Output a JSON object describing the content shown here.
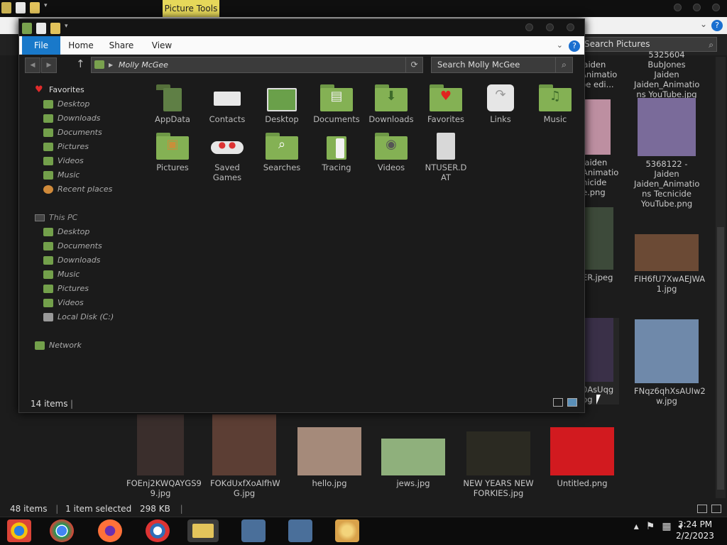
{
  "background_window": {
    "contextual_tab": "Picture Tools",
    "search_placeholder": "Search Pictures",
    "items": [
      {
        "label": "5325604 BubJones Jaiden Jaiden_Animatio ns YouTube.jpg"
      },
      {
        "label": "5368122 - Jaiden Jaiden_Animatio ns Tecnicide YouTube.png"
      },
      {
        "label": "FIH6fU7XwAEJWA 1.jpg"
      },
      {
        "label": "FNqz6qhXsAUIw2 w.jpg"
      },
      {
        "label": "FOEnj2KWQAYGS9 9.jpg"
      },
      {
        "label": "FOKdUxfXoAIfhW G.jpg"
      },
      {
        "label": "hello.jpg"
      },
      {
        "label": "jews.jpg"
      },
      {
        "label": "NEW YEARS NEW FORKIES.jpg"
      },
      {
        "label": "Untitled.png"
      }
    ],
    "partial_labels": [
      "Jaiden Animatio pe edi...",
      "Jaiden Animatio nicide e.png",
      "ER.jpeg",
      "0AsUqg pg"
    ],
    "status": {
      "count": "48 items",
      "selected": "1 item selected",
      "size": "298 KB"
    }
  },
  "window": {
    "ribbon_tabs": {
      "file": "File",
      "home": "Home",
      "share": "Share",
      "view": "View"
    },
    "help": "?",
    "address": "Molly McGee",
    "search_placeholder": "Search Molly McGee",
    "nav": {
      "favorites_header": "Favorites",
      "favorites": [
        "Desktop",
        "Downloads",
        "Documents",
        "Pictures",
        "Videos",
        "Music",
        "Recent places"
      ],
      "thispc_header": "This PC",
      "thispc": [
        "Desktop",
        "Documents",
        "Downloads",
        "Music",
        "Pictures",
        "Videos",
        "Local Disk (C:)"
      ],
      "network": "Network"
    },
    "items": [
      {
        "label": "AppData",
        "icon": "appdata-folder-icon"
      },
      {
        "label": "Contacts",
        "icon": "contacts-icon"
      },
      {
        "label": "Desktop",
        "icon": "desktop-folder-icon"
      },
      {
        "label": "Documents",
        "icon": "documents-folder-icon"
      },
      {
        "label": "Downloads",
        "icon": "downloads-folder-icon"
      },
      {
        "label": "Favorites",
        "icon": "favorites-folder-icon"
      },
      {
        "label": "Links",
        "icon": "links-icon"
      },
      {
        "label": "Music",
        "icon": "music-folder-icon"
      },
      {
        "label": "Pictures",
        "icon": "pictures-folder-icon"
      },
      {
        "label": "Saved Games",
        "icon": "saved-games-icon"
      },
      {
        "label": "Searches",
        "icon": "searches-folder-icon"
      },
      {
        "label": "Tracing",
        "icon": "tracing-folder-icon"
      },
      {
        "label": "Videos",
        "icon": "videos-folder-icon"
      },
      {
        "label": "NTUSER.DAT",
        "icon": "file-icon"
      }
    ],
    "status": {
      "count": "14 items"
    }
  },
  "taskbar": {
    "apps": [
      "chrome-beta-icon",
      "chrome-icon",
      "firefox-icon",
      "obama-logo-icon",
      "file-explorer-icon",
      "installer-icon",
      "installer-icon-2",
      "paint-icon"
    ],
    "clock": {
      "time": "3:24 PM",
      "date": "2/2/2023"
    }
  },
  "colors": {
    "folder_green": "#84b154",
    "ribbon_file": "#1979ca",
    "contextual_tab": "#e6d85a"
  }
}
